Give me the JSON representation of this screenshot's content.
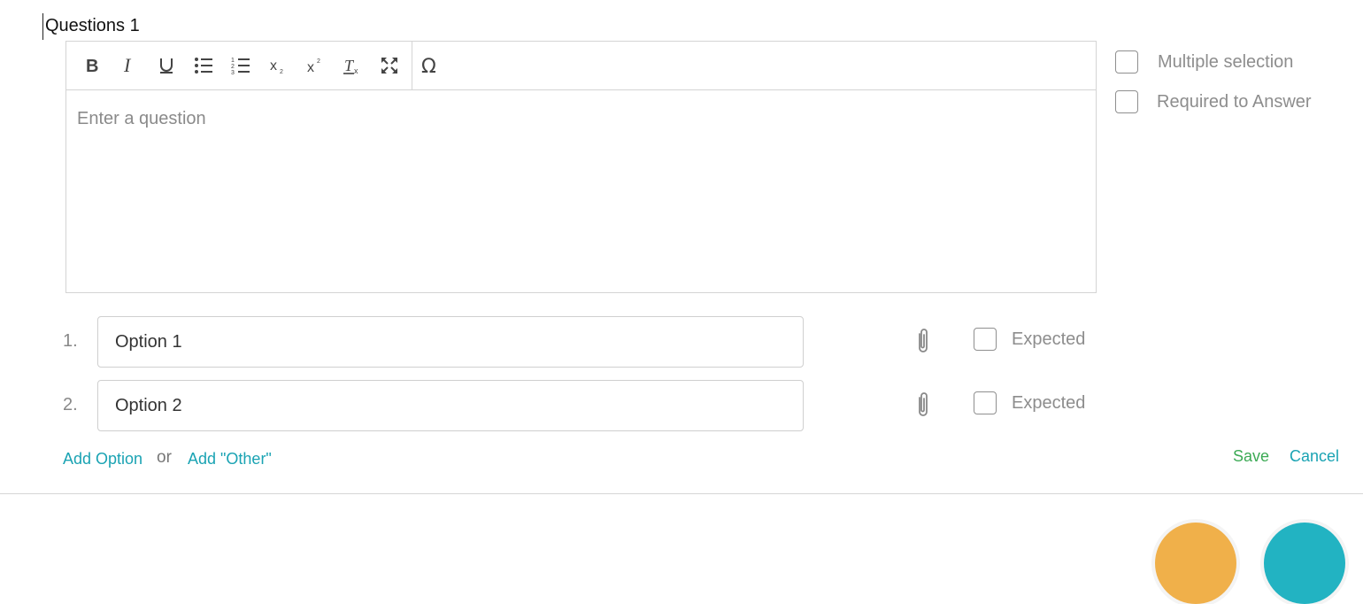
{
  "question": {
    "title": "Questions 1",
    "placeholder": "Enter a question"
  },
  "toolbar": {
    "buttons": [
      {
        "name": "bold",
        "icon": "bold-icon"
      },
      {
        "name": "italic",
        "icon": "italic-icon"
      },
      {
        "name": "underline",
        "icon": "underline-icon"
      },
      {
        "name": "bulleted-list",
        "icon": "bulleted-list-icon"
      },
      {
        "name": "numbered-list",
        "icon": "numbered-list-icon"
      },
      {
        "name": "subscript",
        "icon": "subscript-icon"
      },
      {
        "name": "superscript",
        "icon": "superscript-icon"
      },
      {
        "name": "clear-format",
        "icon": "clear-format-icon"
      },
      {
        "name": "maximize",
        "icon": "maximize-icon"
      },
      {
        "name": "special-char",
        "icon": "omega-icon"
      }
    ]
  },
  "settings": {
    "multiple_selection": {
      "label": "Multiple selection",
      "checked": false
    },
    "required": {
      "label": "Required to Answer",
      "checked": false
    }
  },
  "options": [
    {
      "number": "1.",
      "value": "Option 1",
      "expected_label": "Expected",
      "expected_checked": false
    },
    {
      "number": "2.",
      "value": "Option 2",
      "expected_label": "Expected",
      "expected_checked": false
    }
  ],
  "footer": {
    "add_option": "Add Option",
    "or": "or",
    "add_other": "Add \"Other\"",
    "save": "Save",
    "cancel": "Cancel"
  },
  "colors": {
    "link": "#1aa3b3",
    "save": "#3caa55",
    "fab_left": "#f0b04a",
    "fab_right": "#22b3c2"
  }
}
